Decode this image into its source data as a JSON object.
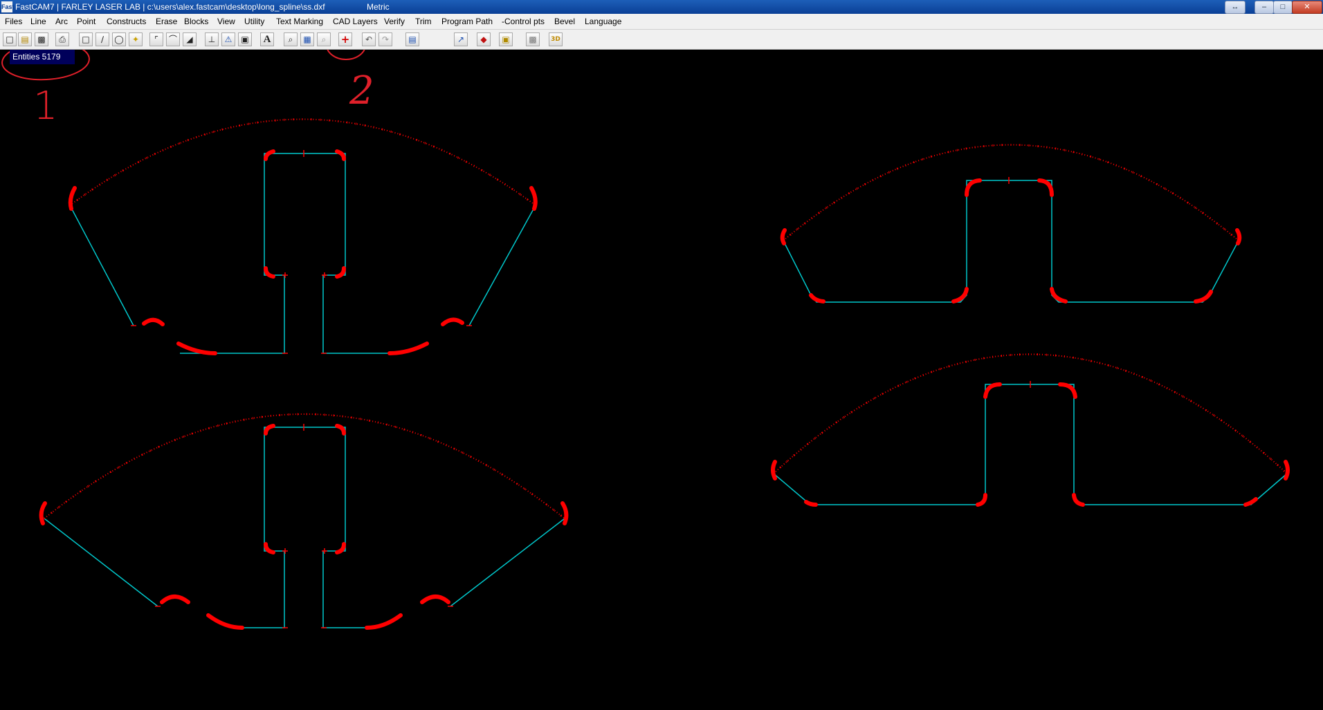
{
  "window": {
    "title": "FastCAM7  |  FARLEY LASER LAB  |  c:\\users\\alex.fastcam\\desktop\\long_spline\\ss.dxf",
    "units": "Metric",
    "app_icon_text": "Fast"
  },
  "menu": [
    "Files",
    "Line",
    "Arc",
    "Point",
    "Constructs",
    "Erase",
    "Blocks",
    "View",
    "Utility",
    "Text Marking",
    "CAD Layers",
    "Verify",
    "Trim",
    "Program Path",
    "-Control pts",
    "Bevel",
    "Language"
  ],
  "toolbar": {
    "text_tool_glyph": "A",
    "add_point_glyph": "+",
    "three_d_glyph": "3D"
  },
  "status": {
    "entities_label": "Entities 5179"
  },
  "annotations": {
    "label_1": "1",
    "label_2": "2"
  },
  "colors": {
    "background": "#000000",
    "line_entities": "#00c8cc",
    "arc_entities": "#ff0000",
    "annotation": "#e0202a",
    "entities_badge": "#00005a"
  }
}
